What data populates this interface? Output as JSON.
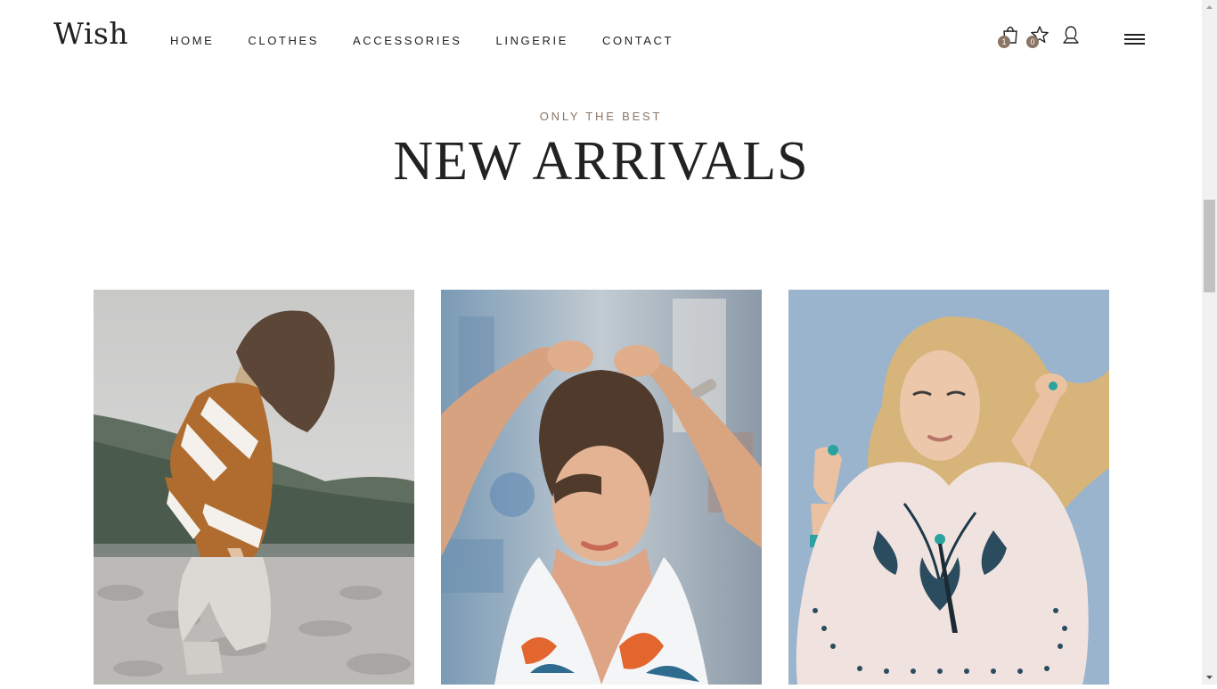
{
  "header": {
    "logo": "Wish",
    "nav": [
      {
        "label": "HOME"
      },
      {
        "label": "CLOTHES"
      },
      {
        "label": "ACCESSORIES"
      },
      {
        "label": "LINGERIE"
      },
      {
        "label": "CONTACT"
      }
    ],
    "cart_icon": "shopping-bag-icon",
    "cart_count": "1",
    "wishlist_icon": "star-icon",
    "wishlist_count": "0",
    "account_icon": "user-icon",
    "menu_icon": "hamburger-menu-icon"
  },
  "section": {
    "eyebrow": "ONLY THE BEST",
    "title": "NEW ARRIVALS"
  },
  "products": [
    {
      "image": "woman-orange-white-sweater-lakeside-photo"
    },
    {
      "image": "woman-floral-top-hair-up-photo"
    },
    {
      "image": "woman-embroidered-blouse-turquoise-jewelry-photo"
    }
  ],
  "colors": {
    "accent": "#8a7566",
    "text": "#222222",
    "background": "#ffffff"
  }
}
